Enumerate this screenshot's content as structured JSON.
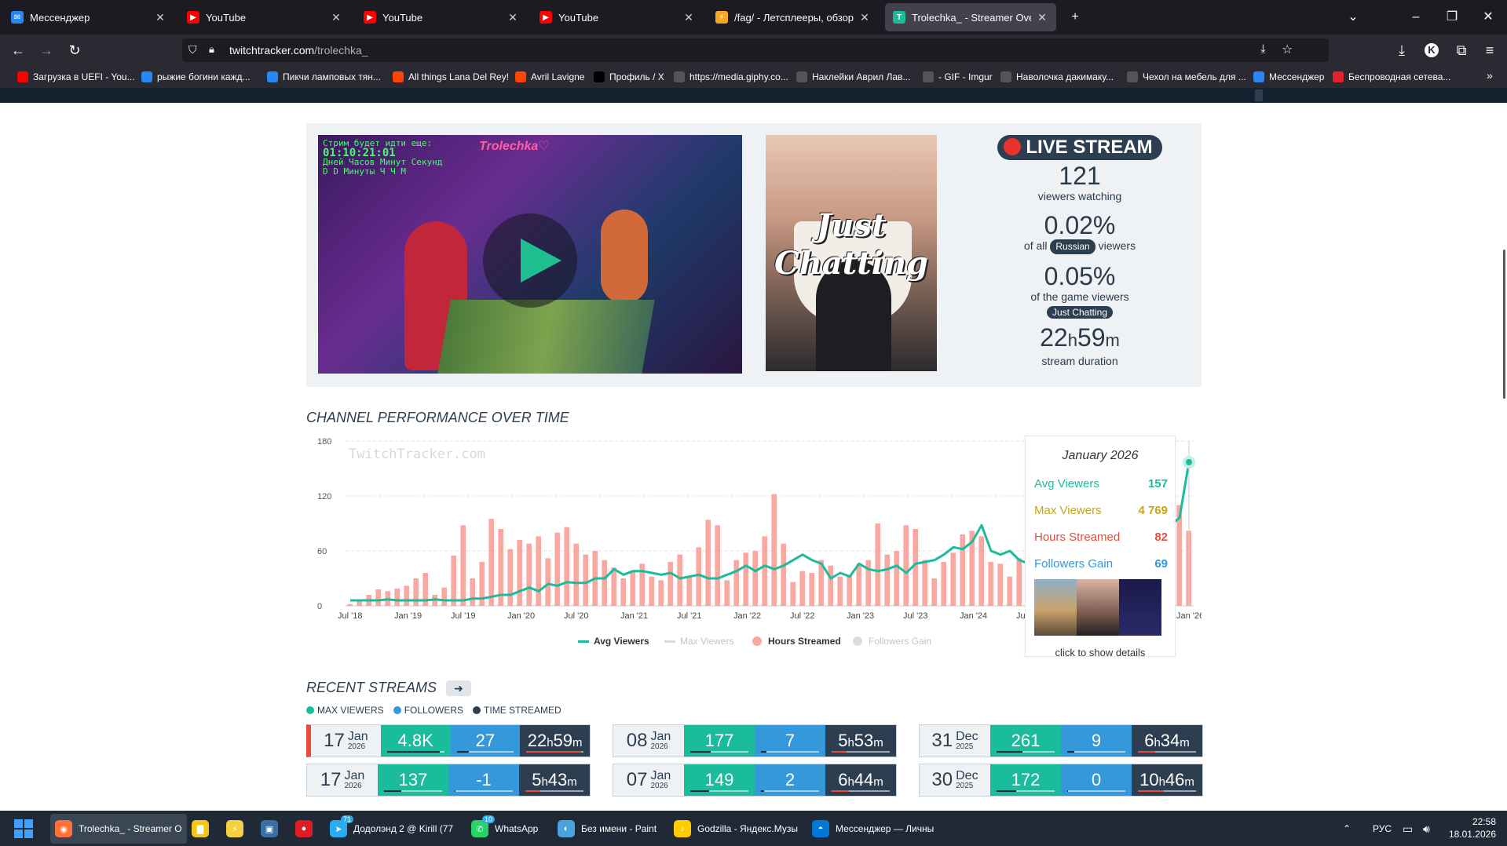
{
  "browser": {
    "tabs": [
      {
        "title": "Мессенджер",
        "icon": "messenger-icon",
        "color": "#2787f5"
      },
      {
        "title": "YouTube",
        "icon": "youtube-icon",
        "color": "#ff0000"
      },
      {
        "title": "YouTube",
        "icon": "youtube-icon",
        "color": "#ff0000"
      },
      {
        "title": "YouTube",
        "icon": "youtube-icon",
        "color": "#ff0000"
      },
      {
        "title": "/fag/ - Летсплееры, обзорщики",
        "icon": "lightning-icon",
        "color": "#f5a623"
      },
      {
        "title": "Trolechka_ - Streamer Overview",
        "icon": "twitchtracker-icon",
        "color": "#1abc9c"
      }
    ],
    "url_host": "twitchtracker.com",
    "url_path": "/trolechka_",
    "bookmarks": [
      {
        "label": "Загрузка в UEFI - You...",
        "color": "#ff0000"
      },
      {
        "label": "рыжие богини кажд...",
        "color": "#2787f5"
      },
      {
        "label": "Пикчи ламповых тян...",
        "color": "#2787f5"
      },
      {
        "label": "All things Lana Del Rey!",
        "color": "#ff4500"
      },
      {
        "label": "Avril Lavigne",
        "color": "#ff4500"
      },
      {
        "label": "Профиль / X",
        "color": "#000000"
      },
      {
        "label": "https://media.giphy.co...",
        "color": "#555555"
      },
      {
        "label": "Наклейки Аврил Лав...",
        "color": "#555555"
      },
      {
        "label": "- GIF - Imgur",
        "color": "#555555"
      },
      {
        "label": "Наволочка дакимаку...",
        "color": "#555555"
      },
      {
        "label": "Чехол на мебель для ...",
        "color": "#555555"
      },
      {
        "label": "Мессенджер",
        "color": "#2787f5"
      },
      {
        "label": "Беспроводная сетева...",
        "color": "#e4202d"
      }
    ]
  },
  "hero": {
    "thumb_overlay_lines": [
      "Стрим будет идти еще:",
      "01:10:21:01",
      "Дней Часов Минут Секунд",
      "D D Минуты Ч Ч M"
    ],
    "thumb_logo": "Trolechka♡",
    "game_title_line1": "Just",
    "game_title_line2": "Chatting",
    "live_label": "LIVE STREAM",
    "viewers": "121",
    "viewers_label": "viewers watching",
    "share_all": "0.02%",
    "share_all_prefix": "of all",
    "share_all_lang": "Russian",
    "share_all_suffix": "viewers",
    "share_game": "0.05%",
    "share_game_label": "of the game viewers",
    "game_pill": "Just Chatting",
    "duration_h": "22",
    "duration_h_unit": "h",
    "duration_m": "59",
    "duration_m_unit": "m",
    "duration_label": "stream duration"
  },
  "performance": {
    "title": "CHANNEL PERFORMANCE OVER TIME",
    "watermark": "TwitchTracker.com",
    "legend": [
      {
        "label": "Avg Viewers",
        "color": "#1abc9c",
        "shape": "line",
        "active": true
      },
      {
        "label": "Max Viewers",
        "color": "#dcdcdc",
        "shape": "line",
        "active": false
      },
      {
        "label": "Hours Streamed",
        "color": "#f7a8a0",
        "shape": "dot",
        "active": true
      },
      {
        "label": "Followers Gain",
        "color": "#dcdcdc",
        "shape": "dot",
        "active": false
      }
    ],
    "tooltip": {
      "title": "January 2026",
      "rows": [
        {
          "label": "Avg Viewers",
          "value": "157",
          "color": "#1abc9c"
        },
        {
          "label": "Max Viewers",
          "value": "4 769",
          "color": "#c8a415"
        },
        {
          "label": "Hours Streamed",
          "value": "82",
          "color": "#e74c3c"
        },
        {
          "label": "Followers Gain",
          "value": "69",
          "color": "#3498db"
        }
      ],
      "images": [
        "gta-sa-cover-icon",
        "just-chatting-cover-icon",
        "only-sleeping-cover-icon"
      ],
      "footer": "click to show details"
    }
  },
  "chart_data": {
    "type": "bar",
    "title": "CHANNEL PERFORMANCE OVER TIME",
    "xlabel": "",
    "ylabel": "",
    "ylim": [
      0,
      180
    ],
    "yticks": [
      0,
      60,
      120,
      180
    ],
    "x_ticks": [
      "Jul '18",
      "Jan '19",
      "Jul '19",
      "Jan '20",
      "Jul '20",
      "Jan '21",
      "Jul '21",
      "Jan '22",
      "Jul '22",
      "Jan '23",
      "Jul '23",
      "Jan '24",
      "Jul '24",
      "Jan '26"
    ],
    "x_start": "2018-07",
    "x_end": "2026-01",
    "grid": true,
    "series": [
      {
        "name": "Hours Streamed",
        "type": "bar",
        "color": "#f7a8a0",
        "values": [
          2,
          5,
          12,
          18,
          16,
          19,
          22,
          30,
          36,
          12,
          20,
          55,
          88,
          30,
          48,
          95,
          84,
          62,
          72,
          68,
          76,
          52,
          80,
          86,
          68,
          56,
          60,
          50,
          42,
          30,
          38,
          46,
          32,
          28,
          48,
          56,
          32,
          64,
          94,
          88,
          28,
          50,
          58,
          60,
          76,
          122,
          68,
          26,
          38,
          36,
          50,
          44,
          32,
          34,
          46,
          50,
          90,
          56,
          60,
          88,
          84,
          50,
          30,
          48,
          58,
          78,
          82,
          76,
          48,
          46,
          32,
          52,
          86,
          58,
          122,
          130,
          98,
          126,
          142,
          138,
          114,
          122,
          70,
          84,
          142,
          110,
          118,
          132,
          110,
          82
        ]
      },
      {
        "name": "Avg Viewers",
        "type": "line",
        "color": "#1abc9c",
        "values": [
          6,
          6,
          6,
          6,
          7,
          6,
          6,
          6,
          6,
          7,
          6,
          6,
          6,
          8,
          8,
          10,
          12,
          12,
          16,
          20,
          16,
          24,
          22,
          26,
          25,
          25,
          30,
          30,
          40,
          34,
          38,
          38,
          36,
          34,
          36,
          30,
          32,
          34,
          30,
          30,
          34,
          38,
          44,
          38,
          44,
          40,
          44,
          50,
          56,
          50,
          46,
          30,
          36,
          32,
          46,
          40,
          38,
          40,
          44,
          36,
          46,
          48,
          50,
          56,
          64,
          62,
          70,
          88,
          60,
          56,
          60,
          50,
          46,
          42,
          36,
          44,
          44,
          62,
          50,
          52,
          58,
          62,
          70,
          110,
          80,
          86,
          84,
          88,
          96,
          157
        ]
      },
      {
        "name": "Max Viewers",
        "type": "line",
        "color": "#dcdcdc",
        "values": []
      },
      {
        "name": "Followers Gain",
        "type": "bar",
        "color": "#dcdcdc",
        "values": []
      }
    ],
    "legend": "bottom"
  },
  "recent": {
    "title": "RECENT STREAMS",
    "legend": [
      {
        "label": "MAX VIEWERS",
        "color": "#1abc9c"
      },
      {
        "label": "FOLLOWERS",
        "color": "#3498db"
      },
      {
        "label": "TIME STREAMED",
        "color": "#2c3e50"
      }
    ],
    "streams": [
      {
        "day": "17",
        "mon": "Jan",
        "year": "2026",
        "viewers": "4.8K",
        "followers": "27",
        "h": "22",
        "m": "59",
        "live": true,
        "vfill": 0.9,
        "ffill": 0.2,
        "tfill": 0.95
      },
      {
        "day": "08",
        "mon": "Jan",
        "year": "2026",
        "viewers": "177",
        "followers": "7",
        "h": "5",
        "m": "53",
        "live": false,
        "vfill": 0.35,
        "ffill": 0.1,
        "tfill": 0.25
      },
      {
        "day": "31",
        "mon": "Dec",
        "year": "2025",
        "viewers": "261",
        "followers": "9",
        "h": "6",
        "m": "34",
        "live": false,
        "vfill": 0.45,
        "ffill": 0.12,
        "tfill": 0.3
      },
      {
        "day": "17",
        "mon": "Jan",
        "year": "2026",
        "viewers": "137",
        "followers": "-1",
        "h": "5",
        "m": "43",
        "live": false,
        "vfill": 0.3,
        "ffill": 0.02,
        "tfill": 0.25
      },
      {
        "day": "07",
        "mon": "Jan",
        "year": "2026",
        "viewers": "149",
        "followers": "2",
        "h": "6",
        "m": "44",
        "live": false,
        "vfill": 0.32,
        "ffill": 0.05,
        "tfill": 0.3
      },
      {
        "day": "30",
        "mon": "Dec",
        "year": "2025",
        "viewers": "172",
        "followers": "0",
        "h": "10",
        "m": "46",
        "live": false,
        "vfill": 0.34,
        "ffill": 0.02,
        "tfill": 0.45
      }
    ],
    "unit_h": "h",
    "unit_m": "m"
  },
  "taskbar": {
    "items": [
      {
        "label": "Trolechka_ - Streamer O",
        "color": "#ff7139",
        "icon": "firefox-icon"
      },
      {
        "label": "",
        "color": "#f5c518",
        "icon": "file-explorer-icon"
      },
      {
        "label": "",
        "color": "#f5d142",
        "icon": "winamp-icon"
      },
      {
        "label": "",
        "color": "#3a6ea5",
        "icon": "floppy-icon"
      },
      {
        "label": "",
        "color": "#e01b24",
        "icon": "record-icon"
      },
      {
        "label": "Додолэнд 2 @ Kirill (77",
        "color": "#2aabee",
        "icon": "telegram-icon",
        "badge": "71"
      },
      {
        "label": "WhatsApp",
        "color": "#25d366",
        "icon": "whatsapp-icon",
        "badge": "10"
      },
      {
        "label": "Без имени - Paint",
        "color": "#4aa3df",
        "icon": "paint-icon"
      },
      {
        "label": "Godzilla - Яндекс.Музы",
        "color": "#ffcc00",
        "icon": "yandex-music-icon"
      },
      {
        "label": "Мессенджер — Личны",
        "color": "#0078d7",
        "icon": "edge-icon"
      }
    ],
    "lang": "РУС",
    "time": "22:58",
    "date": "18.01.2026"
  }
}
